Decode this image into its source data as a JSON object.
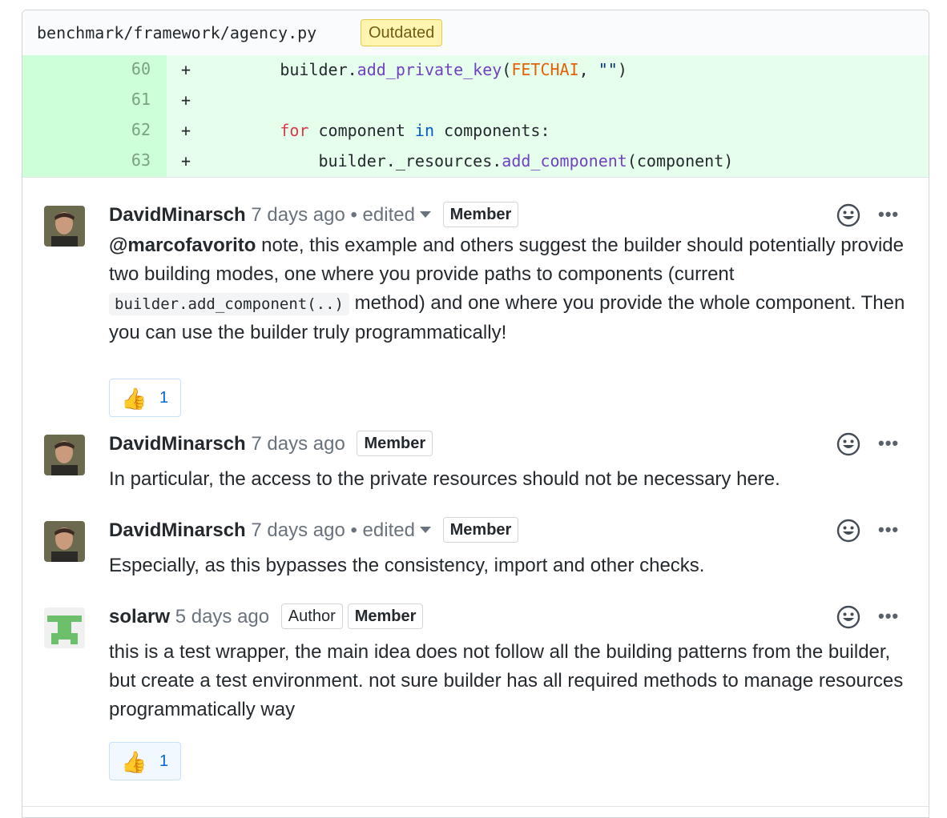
{
  "file": {
    "path": "benchmark/framework/agency.py",
    "badge": "Outdated"
  },
  "code": {
    "lines": [
      {
        "num": "60",
        "marker": "+"
      },
      {
        "num": "61",
        "marker": "+"
      },
      {
        "num": "62",
        "marker": "+"
      },
      {
        "num": "63",
        "marker": "+"
      }
    ],
    "l60": {
      "indent": "        ",
      "obj": "builder.",
      "fn": "add_private_key",
      "open": "(",
      "const": "FETCHAI",
      "comma": ", ",
      "str": "\"\"",
      "close": ")"
    },
    "l62": {
      "indent": "        ",
      "kw": "for",
      "mid": " component ",
      "kw2": "in",
      "rest": " components:"
    },
    "l63": {
      "indent": "            ",
      "obj": "builder._resources.",
      "fn": "add_component",
      "rest": "(component)"
    }
  },
  "comments": [
    {
      "author": "DavidMinarsch",
      "time": "7 days ago",
      "edited": "• edited",
      "badges": [
        "Member"
      ],
      "mention": "@marcofavorito",
      "text_a": " note, this example and others suggest the builder should potentially provide two building modes, one where you provide paths to components (current ",
      "code": "builder.add_component(..)",
      "text_b": " method) and one where you provide the whole component. Then you can use the builder truly programmatically!",
      "reaction": {
        "emoji": "👍",
        "count": "1"
      }
    },
    {
      "author": "DavidMinarsch",
      "time": "7 days ago",
      "badges": [
        "Member"
      ],
      "text": "In particular, the access to the private resources should not be necessary here."
    },
    {
      "author": "DavidMinarsch",
      "time": "7 days ago",
      "edited": "• edited",
      "badges": [
        "Member"
      ],
      "text": "Especially, as this bypasses the consistency, import and other checks."
    },
    {
      "author": "solarw",
      "time": "5 days ago",
      "badges": [
        "Author",
        "Member"
      ],
      "text": "this is a test wrapper, the main idea does not follow all the building patterns from the builder, but create a test environment. not sure builder has all required methods to manage resources programmatically way",
      "reaction": {
        "emoji": "👍",
        "count": "1"
      }
    }
  ],
  "icons": {
    "emoji": "smiley-icon",
    "more": "kebab-horizontal-icon",
    "thumb": "thumbs-up-icon"
  },
  "more_glyph": "•••",
  "colors": {
    "addition_bg": "#e6ffed",
    "addition_num_bg": "#cdffd8",
    "outdated_bg": "#fff5b1",
    "link_blue": "#0366d6"
  }
}
